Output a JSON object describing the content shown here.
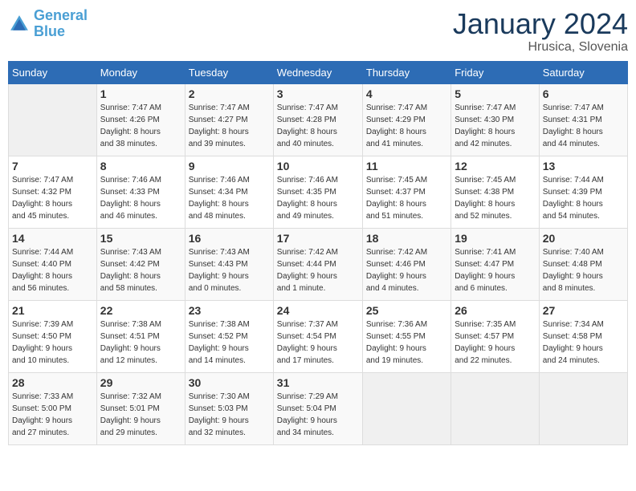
{
  "logo": {
    "text_general": "General",
    "text_blue": "Blue"
  },
  "title": "January 2024",
  "location": "Hrusica, Slovenia",
  "days_header": [
    "Sunday",
    "Monday",
    "Tuesday",
    "Wednesday",
    "Thursday",
    "Friday",
    "Saturday"
  ],
  "weeks": [
    [
      {
        "day": "",
        "sunrise": "",
        "sunset": "",
        "daylight": ""
      },
      {
        "day": "1",
        "sunrise": "Sunrise: 7:47 AM",
        "sunset": "Sunset: 4:26 PM",
        "daylight": "Daylight: 8 hours and 38 minutes."
      },
      {
        "day": "2",
        "sunrise": "Sunrise: 7:47 AM",
        "sunset": "Sunset: 4:27 PM",
        "daylight": "Daylight: 8 hours and 39 minutes."
      },
      {
        "day": "3",
        "sunrise": "Sunrise: 7:47 AM",
        "sunset": "Sunset: 4:28 PM",
        "daylight": "Daylight: 8 hours and 40 minutes."
      },
      {
        "day": "4",
        "sunrise": "Sunrise: 7:47 AM",
        "sunset": "Sunset: 4:29 PM",
        "daylight": "Daylight: 8 hours and 41 minutes."
      },
      {
        "day": "5",
        "sunrise": "Sunrise: 7:47 AM",
        "sunset": "Sunset: 4:30 PM",
        "daylight": "Daylight: 8 hours and 42 minutes."
      },
      {
        "day": "6",
        "sunrise": "Sunrise: 7:47 AM",
        "sunset": "Sunset: 4:31 PM",
        "daylight": "Daylight: 8 hours and 44 minutes."
      }
    ],
    [
      {
        "day": "7",
        "sunrise": "Sunrise: 7:47 AM",
        "sunset": "Sunset: 4:32 PM",
        "daylight": "Daylight: 8 hours and 45 minutes."
      },
      {
        "day": "8",
        "sunrise": "Sunrise: 7:46 AM",
        "sunset": "Sunset: 4:33 PM",
        "daylight": "Daylight: 8 hours and 46 minutes."
      },
      {
        "day": "9",
        "sunrise": "Sunrise: 7:46 AM",
        "sunset": "Sunset: 4:34 PM",
        "daylight": "Daylight: 8 hours and 48 minutes."
      },
      {
        "day": "10",
        "sunrise": "Sunrise: 7:46 AM",
        "sunset": "Sunset: 4:35 PM",
        "daylight": "Daylight: 8 hours and 49 minutes."
      },
      {
        "day": "11",
        "sunrise": "Sunrise: 7:45 AM",
        "sunset": "Sunset: 4:37 PM",
        "daylight": "Daylight: 8 hours and 51 minutes."
      },
      {
        "day": "12",
        "sunrise": "Sunrise: 7:45 AM",
        "sunset": "Sunset: 4:38 PM",
        "daylight": "Daylight: 8 hours and 52 minutes."
      },
      {
        "day": "13",
        "sunrise": "Sunrise: 7:44 AM",
        "sunset": "Sunset: 4:39 PM",
        "daylight": "Daylight: 8 hours and 54 minutes."
      }
    ],
    [
      {
        "day": "14",
        "sunrise": "Sunrise: 7:44 AM",
        "sunset": "Sunset: 4:40 PM",
        "daylight": "Daylight: 8 hours and 56 minutes."
      },
      {
        "day": "15",
        "sunrise": "Sunrise: 7:43 AM",
        "sunset": "Sunset: 4:42 PM",
        "daylight": "Daylight: 8 hours and 58 minutes."
      },
      {
        "day": "16",
        "sunrise": "Sunrise: 7:43 AM",
        "sunset": "Sunset: 4:43 PM",
        "daylight": "Daylight: 9 hours and 0 minutes."
      },
      {
        "day": "17",
        "sunrise": "Sunrise: 7:42 AM",
        "sunset": "Sunset: 4:44 PM",
        "daylight": "Daylight: 9 hours and 1 minute."
      },
      {
        "day": "18",
        "sunrise": "Sunrise: 7:42 AM",
        "sunset": "Sunset: 4:46 PM",
        "daylight": "Daylight: 9 hours and 4 minutes."
      },
      {
        "day": "19",
        "sunrise": "Sunrise: 7:41 AM",
        "sunset": "Sunset: 4:47 PM",
        "daylight": "Daylight: 9 hours and 6 minutes."
      },
      {
        "day": "20",
        "sunrise": "Sunrise: 7:40 AM",
        "sunset": "Sunset: 4:48 PM",
        "daylight": "Daylight: 9 hours and 8 minutes."
      }
    ],
    [
      {
        "day": "21",
        "sunrise": "Sunrise: 7:39 AM",
        "sunset": "Sunset: 4:50 PM",
        "daylight": "Daylight: 9 hours and 10 minutes."
      },
      {
        "day": "22",
        "sunrise": "Sunrise: 7:38 AM",
        "sunset": "Sunset: 4:51 PM",
        "daylight": "Daylight: 9 hours and 12 minutes."
      },
      {
        "day": "23",
        "sunrise": "Sunrise: 7:38 AM",
        "sunset": "Sunset: 4:52 PM",
        "daylight": "Daylight: 9 hours and 14 minutes."
      },
      {
        "day": "24",
        "sunrise": "Sunrise: 7:37 AM",
        "sunset": "Sunset: 4:54 PM",
        "daylight": "Daylight: 9 hours and 17 minutes."
      },
      {
        "day": "25",
        "sunrise": "Sunrise: 7:36 AM",
        "sunset": "Sunset: 4:55 PM",
        "daylight": "Daylight: 9 hours and 19 minutes."
      },
      {
        "day": "26",
        "sunrise": "Sunrise: 7:35 AM",
        "sunset": "Sunset: 4:57 PM",
        "daylight": "Daylight: 9 hours and 22 minutes."
      },
      {
        "day": "27",
        "sunrise": "Sunrise: 7:34 AM",
        "sunset": "Sunset: 4:58 PM",
        "daylight": "Daylight: 9 hours and 24 minutes."
      }
    ],
    [
      {
        "day": "28",
        "sunrise": "Sunrise: 7:33 AM",
        "sunset": "Sunset: 5:00 PM",
        "daylight": "Daylight: 9 hours and 27 minutes."
      },
      {
        "day": "29",
        "sunrise": "Sunrise: 7:32 AM",
        "sunset": "Sunset: 5:01 PM",
        "daylight": "Daylight: 9 hours and 29 minutes."
      },
      {
        "day": "30",
        "sunrise": "Sunrise: 7:30 AM",
        "sunset": "Sunset: 5:03 PM",
        "daylight": "Daylight: 9 hours and 32 minutes."
      },
      {
        "day": "31",
        "sunrise": "Sunrise: 7:29 AM",
        "sunset": "Sunset: 5:04 PM",
        "daylight": "Daylight: 9 hours and 34 minutes."
      },
      {
        "day": "",
        "sunrise": "",
        "sunset": "",
        "daylight": ""
      },
      {
        "day": "",
        "sunrise": "",
        "sunset": "",
        "daylight": ""
      },
      {
        "day": "",
        "sunrise": "",
        "sunset": "",
        "daylight": ""
      }
    ]
  ]
}
